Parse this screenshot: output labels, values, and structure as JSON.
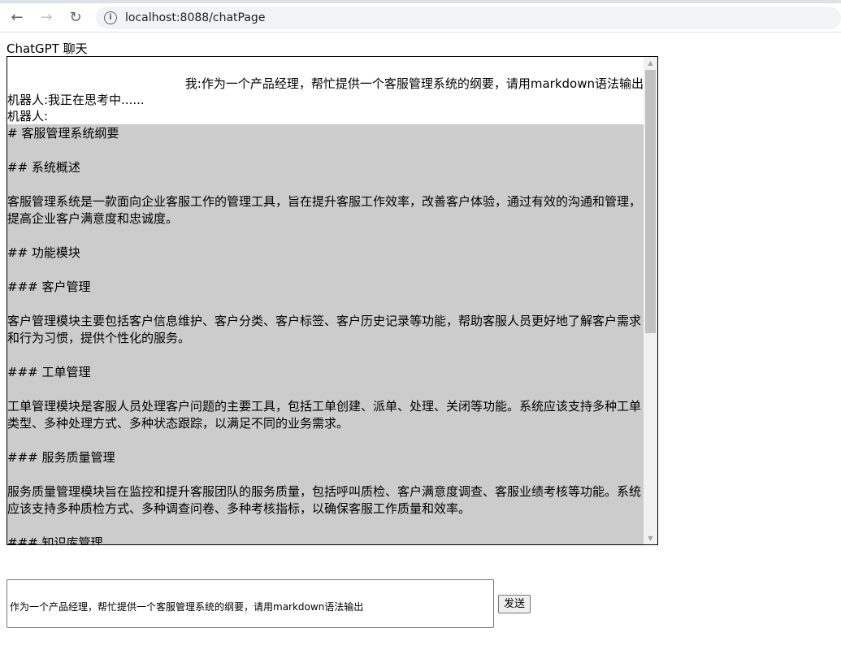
{
  "browser": {
    "url": "localhost:8088/chatPage"
  },
  "page": {
    "title": "ChatGPT 聊天"
  },
  "chat": {
    "user_message": "我:作为一个产品经理，帮忙提供一个客服管理系统的纲要，请用markdown语法输出",
    "bot_thinking": "机器人:我正在思考中......",
    "bot_label": "机器人:",
    "bot_markdown": "# 客服管理系统纲要\n\n## 系统概述\n\n客服管理系统是一款面向企业客服工作的管理工具，旨在提升客服工作效率，改善客户体验，通过有效的沟通和管理，提高企业客户满意度和忠诚度。\n\n## 功能模块\n\n### 客户管理\n\n客户管理模块主要包括客户信息维护、客户分类、客户标签、客户历史记录等功能，帮助客服人员更好地了解客户需求和行为习惯，提供个性化的服务。\n\n### 工单管理\n\n工单管理模块是客服人员处理客户问题的主要工具，包括工单创建、派单、处理、关闭等功能。系统应该支持多种工单类型、多种处理方式、多种状态跟踪，以满足不同的业务需求。\n\n### 服务质量管理\n\n服务质量管理模块旨在监控和提升客服团队的服务质量，包括呼叫质检、客户满意度调查、客服业绩考核等功能。系统应该支持多种质检方式、多种调查问卷、多种考核指标，以确保客服工作质量和效率。\n\n### 知识库管理"
  },
  "composer": {
    "value": "作为一个产品经理，帮忙提供一个客服管理系统的纲要，请用markdown语法输出",
    "send_label": "发送"
  }
}
